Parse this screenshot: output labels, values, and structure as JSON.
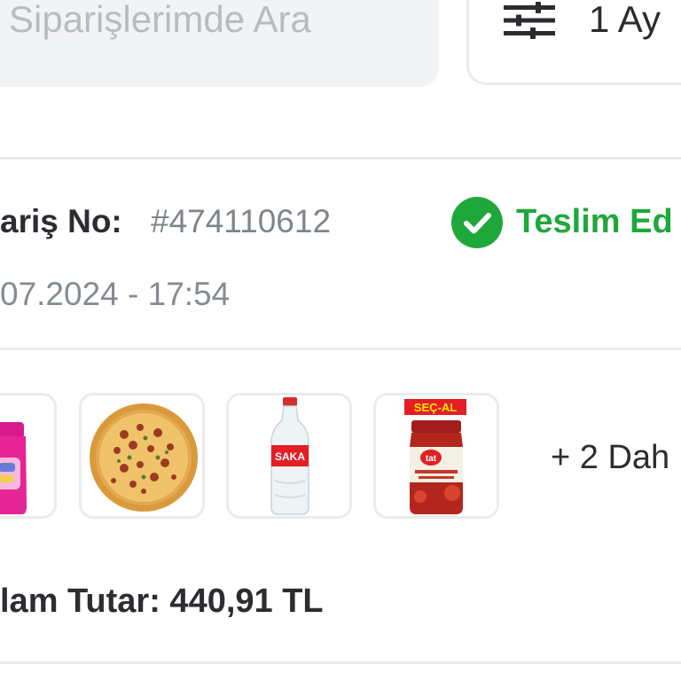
{
  "search": {
    "placeholder": "Siparişlerimde Ara"
  },
  "filter": {
    "label": "1 Ay",
    "icon": "sliders-icon"
  },
  "order": {
    "number_label": "ariş No:",
    "number_value": "#474110612",
    "date": "07.2024 - 17:54",
    "status": "Teslim Ed",
    "status_icon": "check-circle-icon",
    "status_color": "#1fa83a"
  },
  "products": {
    "items": [
      {
        "name": "detergent-bottle",
        "icon": "pink-bottle-icon"
      },
      {
        "name": "pizza",
        "icon": "pizza-icon"
      },
      {
        "name": "water-bottle",
        "icon": "water-bottle-icon",
        "brand": "SAKA"
      },
      {
        "name": "tomato-paste-jar",
        "icon": "jar-icon",
        "badge": "SEÇ-AL",
        "brand": "tat"
      }
    ],
    "more_label": "+ 2 Dah"
  },
  "total": {
    "label": "lam Tutar: 440,91 TL"
  }
}
